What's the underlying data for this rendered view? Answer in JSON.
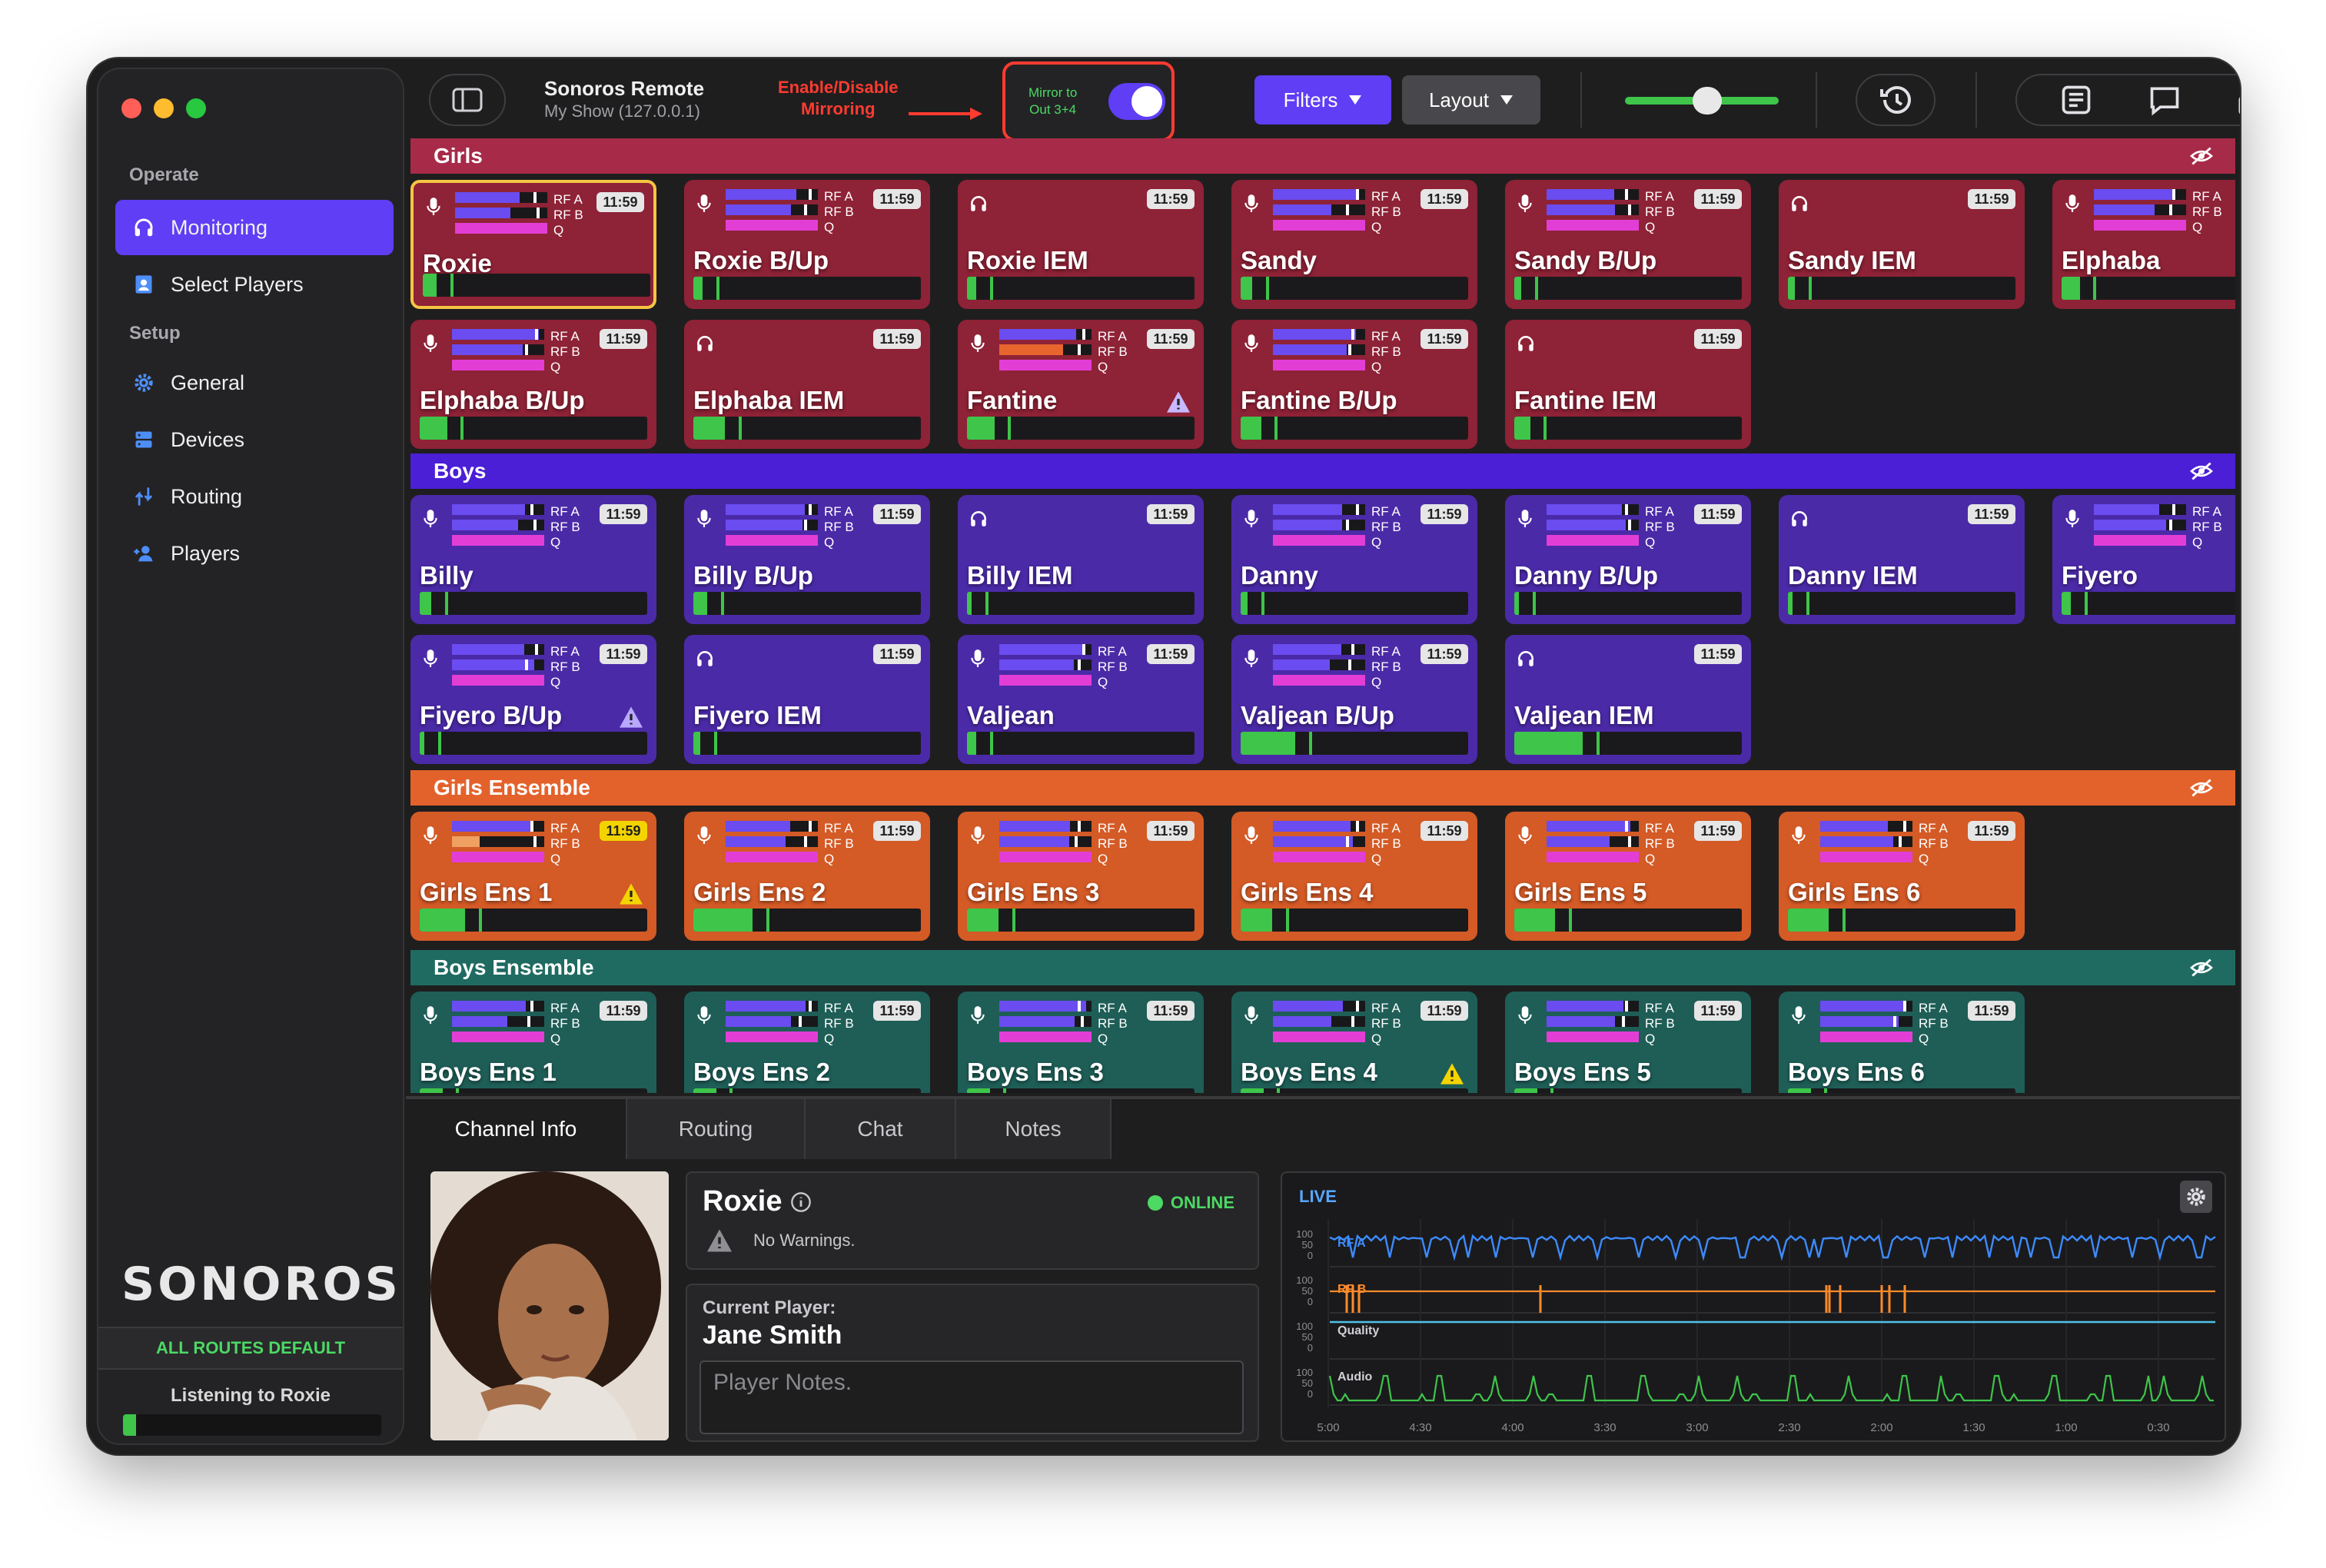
{
  "sidebar": {
    "sections": {
      "operate": "Operate",
      "setup": "Setup"
    },
    "items": [
      {
        "label": "Monitoring",
        "icon": "headphones-icon"
      },
      {
        "label": "Select Players",
        "icon": "contact-card-icon"
      },
      {
        "label": "General",
        "icon": "gear-icon"
      },
      {
        "label": "Devices",
        "icon": "server-icon"
      },
      {
        "label": "Routing",
        "icon": "routing-icon"
      },
      {
        "label": "Players",
        "icon": "add-person-icon"
      }
    ],
    "logo": "SONOROS",
    "routes_status": "ALL ROUTES DEFAULT",
    "listening": "Listening to Roxie",
    "listening_level": 0.05
  },
  "toolbar": {
    "title": "Sonoros Remote",
    "subtitle": "My Show (127.0.0.1)",
    "annotation_line1": "Enable/Disable",
    "annotation_line2": "Mirroring",
    "mirror_line1": "Mirror to",
    "mirror_line2": "Out 3+4",
    "mirror_on": true,
    "filters_label": "Filters",
    "layout_label": "Layout",
    "volume_level": 0.5
  },
  "groups": [
    {
      "name": "Girls",
      "color": "#a72a48",
      "tile": "#8e2236"
    },
    {
      "name": "Boys",
      "color": "#4a1fd6",
      "tile": "#4b2aa8"
    },
    {
      "name": "Girls Ensemble",
      "color": "#e3622c",
      "tile": "#d45a26"
    },
    {
      "name": "Boys Ensemble",
      "color": "#1f6b61",
      "tile": "#1e5e57"
    }
  ],
  "tiles": [
    {
      "name": "Roxie",
      "type": "mic",
      "time": "11:59",
      "meter": 0.06,
      "selected": true,
      "group": 0
    },
    {
      "name": "Roxie B/Up",
      "type": "mic",
      "time": "11:59",
      "meter": 0.04,
      "group": 0
    },
    {
      "name": "Roxie IEM",
      "type": "iem",
      "time": "11:59",
      "meter": 0.04,
      "group": 0
    },
    {
      "name": "Sandy",
      "type": "mic",
      "time": "11:59",
      "meter": 0.05,
      "group": 0
    },
    {
      "name": "Sandy B/Up",
      "type": "mic",
      "time": "11:59",
      "meter": 0.03,
      "group": 0
    },
    {
      "name": "Sandy IEM",
      "type": "iem",
      "time": "11:59",
      "meter": 0.03,
      "group": 0
    },
    {
      "name": "Elphaba",
      "type": "mic",
      "time": "11:59",
      "meter": 0.08,
      "group": 0
    },
    {
      "name": "Elphaba B/Up",
      "type": "mic",
      "time": "11:59",
      "meter": 0.12,
      "group": 0
    },
    {
      "name": "Elphaba IEM",
      "type": "iem",
      "time": "11:59",
      "meter": 0.14,
      "group": 0
    },
    {
      "name": "Fantine",
      "type": "mic",
      "time": "11:59",
      "meter": 0.12,
      "warn": true,
      "group": 0
    },
    {
      "name": "Fantine B/Up",
      "type": "mic",
      "time": "11:59",
      "meter": 0.09,
      "group": 0
    },
    {
      "name": "Fantine IEM",
      "type": "iem",
      "time": "11:59",
      "meter": 0.07,
      "group": 0
    },
    {
      "name": "Billy",
      "type": "mic",
      "time": "11:59",
      "meter": 0.05,
      "group": 1
    },
    {
      "name": "Billy B/Up",
      "type": "mic",
      "time": "11:59",
      "meter": 0.06,
      "group": 1
    },
    {
      "name": "Billy IEM",
      "type": "iem",
      "time": "11:59",
      "meter": 0.02,
      "group": 1
    },
    {
      "name": "Danny",
      "type": "mic",
      "time": "11:59",
      "meter": 0.03,
      "group": 1
    },
    {
      "name": "Danny B/Up",
      "type": "mic",
      "time": "11:59",
      "meter": 0.02,
      "group": 1
    },
    {
      "name": "Danny IEM",
      "type": "iem",
      "time": "11:59",
      "meter": 0.02,
      "group": 1
    },
    {
      "name": "Fiyero",
      "type": "mic",
      "time": "11:59",
      "meter": 0.04,
      "group": 1
    },
    {
      "name": "Fiyero B/Up",
      "type": "mic",
      "time": "11:59",
      "meter": 0.02,
      "warn": true,
      "group": 1
    },
    {
      "name": "Fiyero IEM",
      "type": "iem",
      "time": "11:59",
      "meter": 0.03,
      "group": 1
    },
    {
      "name": "Valjean",
      "type": "mic",
      "time": "11:59",
      "meter": 0.04,
      "group": 1
    },
    {
      "name": "Valjean B/Up",
      "type": "mic",
      "time": "11:59",
      "meter": 0.24,
      "group": 1
    },
    {
      "name": "Valjean IEM",
      "type": "iem",
      "time": "11:59",
      "meter": 0.3,
      "group": 1
    },
    {
      "name": "Girls Ens 1",
      "type": "mic",
      "time": "11:59",
      "meter": 0.2,
      "warn": true,
      "timeWarn": true,
      "group": 2
    },
    {
      "name": "Girls Ens 2",
      "type": "mic",
      "time": "11:59",
      "meter": 0.26,
      "group": 2
    },
    {
      "name": "Girls Ens 3",
      "type": "mic",
      "time": "11:59",
      "meter": 0.14,
      "group": 2
    },
    {
      "name": "Girls Ens 4",
      "type": "mic",
      "time": "11:59",
      "meter": 0.14,
      "group": 2
    },
    {
      "name": "Girls Ens 5",
      "type": "mic",
      "time": "11:59",
      "meter": 0.18,
      "group": 2
    },
    {
      "name": "Girls Ens 6",
      "type": "mic",
      "time": "11:59",
      "meter": 0.18,
      "group": 2
    },
    {
      "name": "Boys Ens 1",
      "type": "mic",
      "time": "11:59",
      "meter": 0.1,
      "group": 3
    },
    {
      "name": "Boys Ens 2",
      "type": "mic",
      "time": "11:59",
      "meter": 0.1,
      "group": 3
    },
    {
      "name": "Boys Ens 3",
      "type": "mic",
      "time": "11:59",
      "meter": 0.1,
      "group": 3
    },
    {
      "name": "Boys Ens 4",
      "type": "mic",
      "time": "11:59",
      "meter": 0.1,
      "warn": true,
      "group": 3
    },
    {
      "name": "Boys Ens 5",
      "type": "mic",
      "time": "11:59",
      "meter": 0.1,
      "group": 3
    },
    {
      "name": "Boys Ens 6",
      "type": "mic",
      "time": "11:59",
      "meter": 0.1,
      "group": 3
    }
  ],
  "tile_labels": {
    "rfa": "RF A",
    "rfb": "RF B",
    "q": "Q"
  },
  "bottom": {
    "tabs": [
      "Channel Info",
      "Routing",
      "Chat",
      "Notes"
    ],
    "channel_name": "Roxie",
    "status": "ONLINE",
    "warnings": "No Warnings.",
    "current_player_label": "Current Player:",
    "current_player": "Jane Smith",
    "notes_placeholder": "Player Notes.",
    "graph": {
      "live": "LIVE",
      "rows": [
        {
          "label": "RF A",
          "color": "#3d8bff"
        },
        {
          "label": "RF B",
          "color": "#ff8a2a"
        },
        {
          "label": "Quality",
          "color": "#4fc3e8"
        },
        {
          "label": "Audio",
          "color": "#3ec54a"
        }
      ],
      "ticks": [
        "100",
        "50",
        "0"
      ],
      "xlabels": [
        "5:00",
        "4:30",
        "4:00",
        "3:30",
        "3:00",
        "2:30",
        "2:00",
        "1:30",
        "1:00",
        "0:30",
        "0:00"
      ]
    }
  }
}
